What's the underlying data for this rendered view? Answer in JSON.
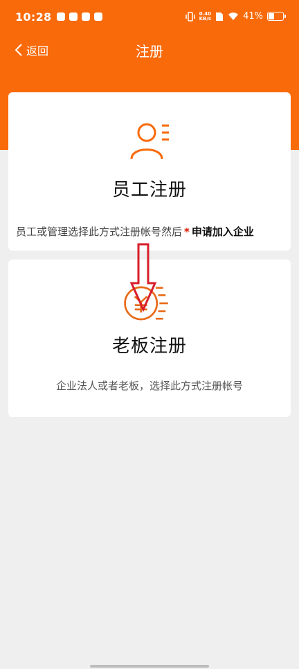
{
  "status_bar": {
    "time": "10:28",
    "net_speed_value": "0.40",
    "net_speed_unit": "KB/s",
    "battery": "41%"
  },
  "navbar": {
    "back_label": "返回",
    "title": "注册"
  },
  "employee_card": {
    "title": "员工注册",
    "desc": "员工或管理选择此方式注册帐号然后",
    "star": "*",
    "desc_bold": "申请加入企业"
  },
  "boss_card": {
    "title": "老板注册",
    "desc": "企业法人或者老板，选择此方式注册帐号"
  },
  "colors": {
    "primary": "#f96a0a",
    "arrow": "#d81e2a"
  }
}
